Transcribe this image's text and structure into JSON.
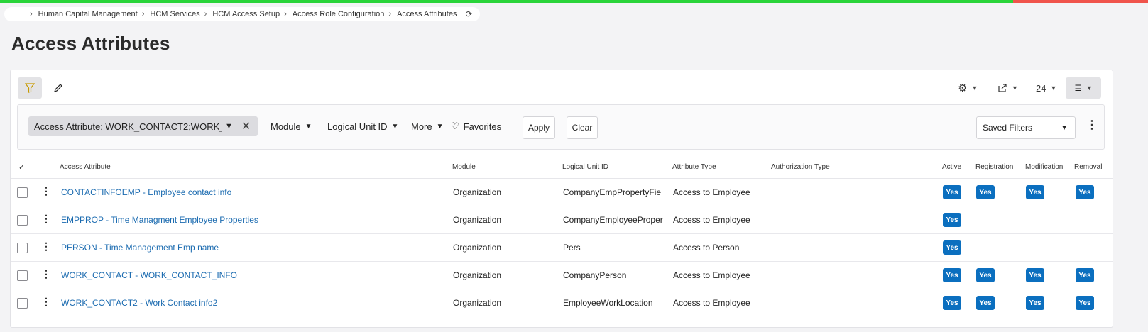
{
  "breadcrumb": {
    "items": [
      "Human Capital Management",
      "HCM Services",
      "HCM Access Setup",
      "Access Role Configuration",
      "Access Attributes"
    ]
  },
  "page": {
    "title": "Access Attributes"
  },
  "toolbar": {
    "page_size": "24"
  },
  "filters": {
    "chip_label": "Access Attribute: WORK_CONTACT2;WORK_C...",
    "module": "Module",
    "logical_unit": "Logical Unit ID",
    "more": "More",
    "favorites": "Favorites",
    "apply": "Apply",
    "clear": "Clear",
    "saved_filters": "Saved Filters"
  },
  "table": {
    "headers": {
      "access_attribute": "Access Attribute",
      "module": "Module",
      "logical_unit_id": "Logical Unit ID",
      "attribute_type": "Attribute Type",
      "authorization_type": "Authorization Type",
      "active": "Active",
      "registration": "Registration",
      "modification": "Modification",
      "removal": "Removal"
    },
    "yes_label": "Yes",
    "rows": [
      {
        "attribute": "CONTACTINFOEMP - Employee contact info",
        "module": "Organization",
        "lu": "CompanyEmpPropertyFie",
        "type": "Access to Employee",
        "active": true,
        "registration": true,
        "modification": true,
        "removal": true
      },
      {
        "attribute": "EMPPROP - Time Managment Employee Properties",
        "module": "Organization",
        "lu": "CompanyEmployeeProper",
        "type": "Access to Employee",
        "active": true,
        "registration": false,
        "modification": false,
        "removal": false
      },
      {
        "attribute": "PERSON - Time Management Emp name",
        "module": "Organization",
        "lu": "Pers",
        "type": "Access to Person",
        "active": true,
        "registration": false,
        "modification": false,
        "removal": false
      },
      {
        "attribute": "WORK_CONTACT - WORK_CONTACT_INFO",
        "module": "Organization",
        "lu": "CompanyPerson",
        "type": "Access to Employee",
        "active": true,
        "registration": true,
        "modification": true,
        "removal": true
      },
      {
        "attribute": "WORK_CONTACT2 - Work Contact info2",
        "module": "Organization",
        "lu": "EmployeeWorkLocation",
        "type": "Access to Employee",
        "active": true,
        "registration": true,
        "modification": true,
        "removal": true
      }
    ]
  }
}
